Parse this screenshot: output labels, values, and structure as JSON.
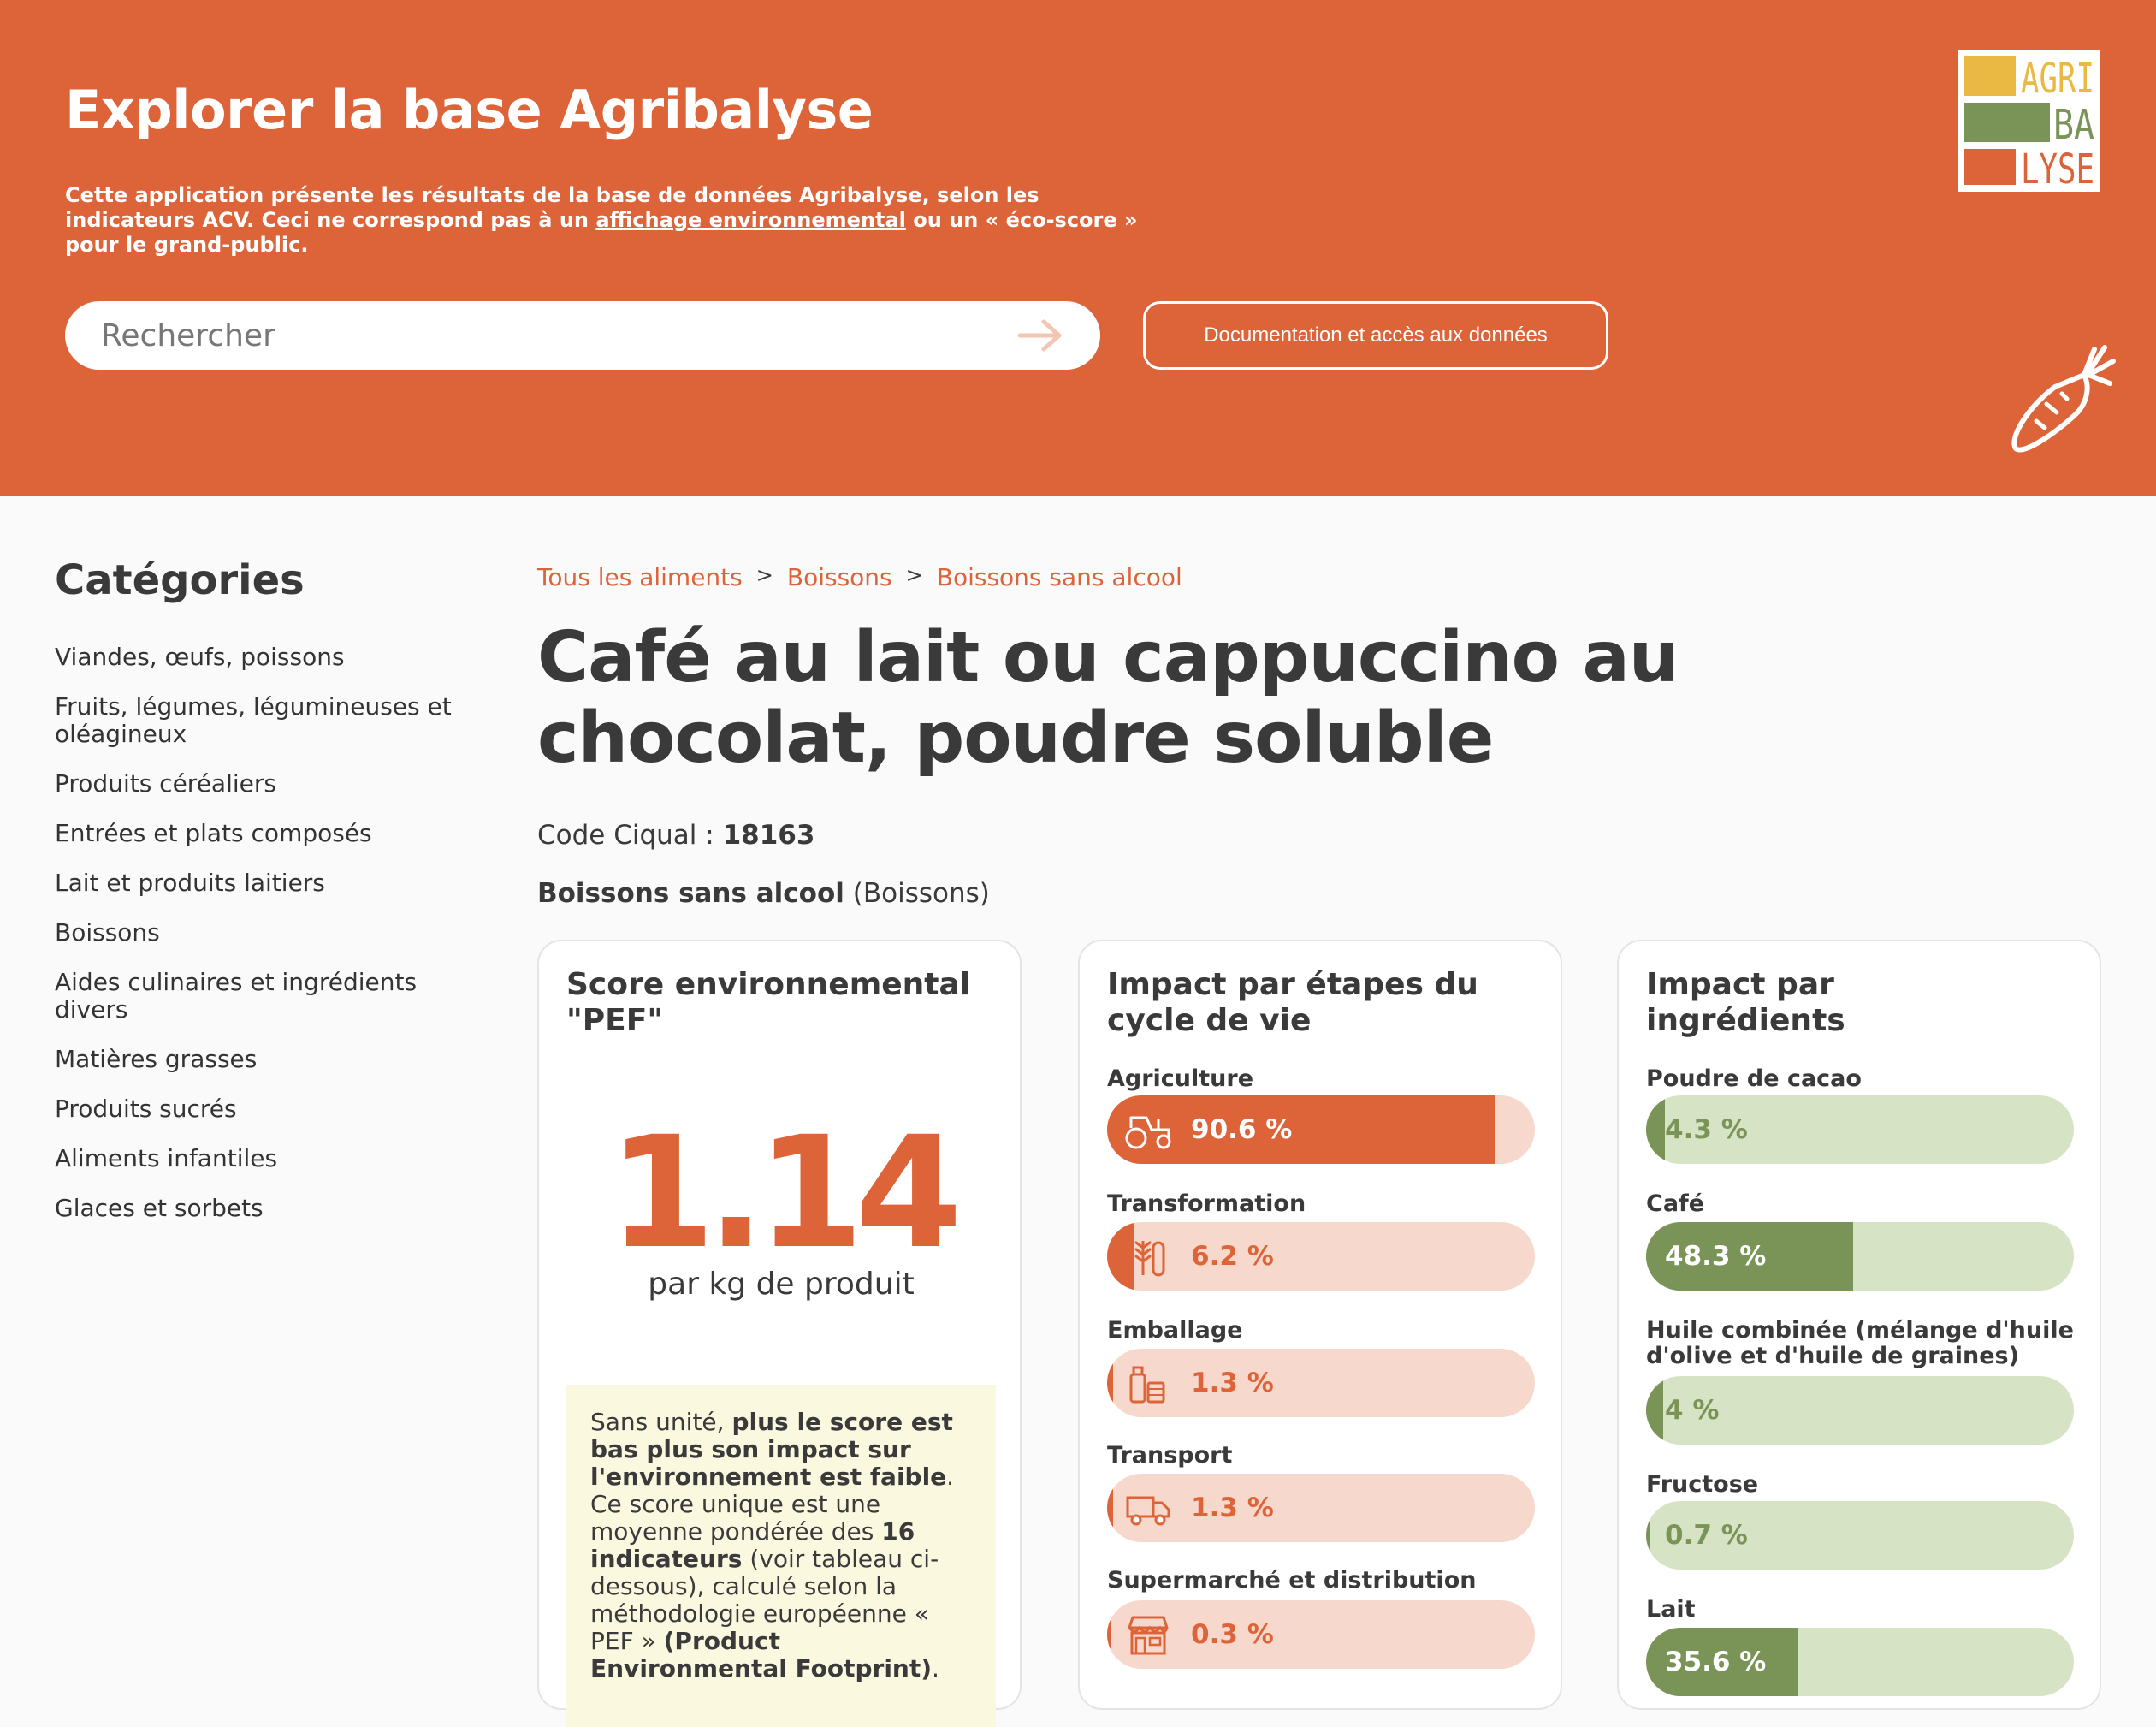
{
  "header": {
    "title": "Explorer la base Agribalyse",
    "desc_pre": "Cette application présente les résultats de la base de données Agribalyse, selon les indicateurs ACV. Ceci ne correspond pas à un ",
    "desc_link": "affichage environnemental",
    "desc_post": " ou un « éco-score » pour le grand-public.",
    "search_placeholder": "Rechercher",
    "doc_button": "Documentation et accès aux données",
    "logo_lines": [
      "AGRI",
      "BA",
      "LYSE"
    ],
    "colors": {
      "background": "#dd6339",
      "logo_yellow": "#e9b944",
      "logo_green": "#7a9356",
      "logo_orange": "#dd6339"
    }
  },
  "sidebar": {
    "title": "Catégories",
    "items": [
      "Viandes, œufs, poissons",
      "Fruits, légumes, légumineuses et oléagineux",
      "Produits céréaliers",
      "Entrées et plats composés",
      "Lait et produits laitiers",
      "Boissons",
      "Aides culinaires et ingrédients divers",
      "Matières grasses",
      "Produits sucrés",
      "Aliments infantiles",
      "Glaces et sorbets"
    ]
  },
  "breadcrumb": [
    "Tous les aliments",
    "Boissons",
    "Boissons sans alcool"
  ],
  "breadcrumb_sep": ">",
  "product": {
    "title": "Café au lait ou cappuccino au chocolat, poudre soluble",
    "ciqual_label": "Code Ciqual : ",
    "ciqual_code": "18163",
    "category": "Boissons sans alcool",
    "group": "(Boissons)"
  },
  "score_card": {
    "title": "Score environnemental \"PEF\"",
    "value": "1.14",
    "unit": "par kg de produit",
    "note": [
      {
        "t": "Sans unité, ",
        "b": false
      },
      {
        "t": "plus le score est bas plus son impact sur l'environnement est faible",
        "b": true
      },
      {
        "t": ". Ce score unique est une moyenne pondérée des ",
        "b": false
      },
      {
        "t": "16 indicateurs",
        "b": true
      },
      {
        "t": " (voir tableau ci-dessous), calculé selon la méthodologie européenne « PEF » ",
        "b": false
      },
      {
        "t": "(Product Environmental Footprint)",
        "b": true
      },
      {
        "t": ".",
        "b": false
      }
    ]
  },
  "stages_card": {
    "title": "Impact par étapes du cycle de vie",
    "color": "#dd6339",
    "stages": [
      {
        "label": "Agriculture",
        "value": "90.6 %",
        "fraction": 0.906,
        "icon": "tractor-icon"
      },
      {
        "label": "Transformation",
        "value": "6.2 %",
        "fraction": 0.062,
        "icon": "wheat-icon"
      },
      {
        "label": "Emballage",
        "value": "1.3 %",
        "fraction": 0.013,
        "icon": "packaging-icon"
      },
      {
        "label": "Transport",
        "value": "1.3 %",
        "fraction": 0.013,
        "icon": "truck-icon"
      },
      {
        "label": "Supermarché et distribution",
        "value": "0.3 %",
        "fraction": 0.003,
        "icon": "store-icon"
      }
    ]
  },
  "ingredients_card": {
    "title": "Impact par ingrédients",
    "color": "#7a9356",
    "ingredients": [
      {
        "label": "Poudre de cacao",
        "value": "4.3 %",
        "fraction": 0.043
      },
      {
        "label": "Café",
        "value": "48.3 %",
        "fraction": 0.483
      },
      {
        "label": "Huile combinée (mélange d'huile d'olive et d'huile de graines)",
        "value": "4 %",
        "fraction": 0.04
      },
      {
        "label": "Fructose",
        "value": "0.7 %",
        "fraction": 0.007
      },
      {
        "label": "Lait",
        "value": "35.6 %",
        "fraction": 0.356
      }
    ]
  }
}
